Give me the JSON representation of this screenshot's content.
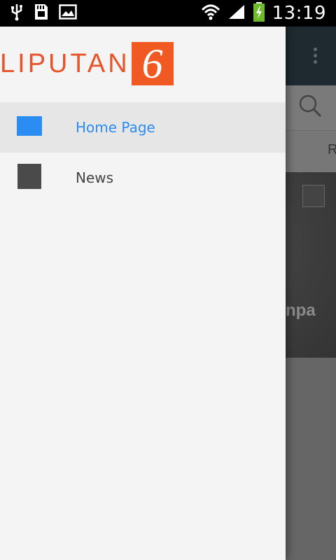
{
  "status_bar": {
    "time": "13:19",
    "icons": [
      "usb-icon",
      "sd-card-icon",
      "image-icon",
      "wifi-icon",
      "signal-icon",
      "battery-charging-icon"
    ]
  },
  "drawer": {
    "logo": {
      "text": "LIPUTAN",
      "number": "6"
    },
    "items": [
      {
        "label": "Home Page",
        "icon": "home-square-icon",
        "active": true,
        "color": "#2b8cf1"
      },
      {
        "label": "News",
        "icon": "news-square-icon",
        "active": false,
        "color": "#444444"
      }
    ]
  },
  "background_app": {
    "tab_partial": "R",
    "photo_text_partial": "npa"
  },
  "colors": {
    "accent": "#2b8cf1",
    "brand": "#f05a22",
    "drawer_bg": "#f4f4f4"
  }
}
